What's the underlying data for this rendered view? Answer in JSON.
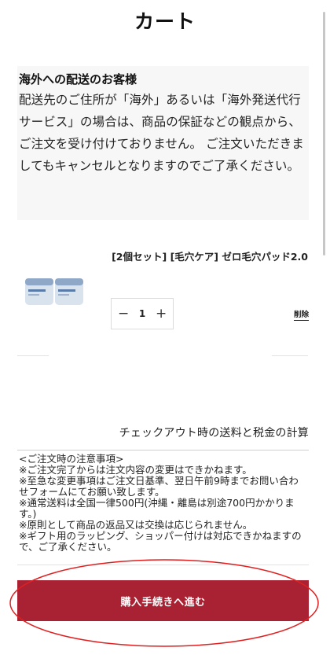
{
  "page": {
    "title": "カート"
  },
  "notice": {
    "heading": "海外への配送のお客様",
    "body": "配送先のご住所が「海外」あるいは「海外発送代行サービス」の場合は、商品の保証などの観点から、ご注文を受け付けておりません。 ご注文いただきましてもキャンセルとなりますのでご了承ください。"
  },
  "cart": {
    "item": {
      "name": "[2個セット] [毛穴ケア] ゼロ毛穴パッド2.0",
      "quantity": "1",
      "minus": "−",
      "plus": "+",
      "delete_label": "削除"
    }
  },
  "checkout": {
    "shipping_tax_note": "チェックアウト時の送料と税金の計算",
    "order_notes": "<ご注文時の注意事項>\n※ご注文完了からは注文内容の変更はできかねます。\n※至急な変更事項はご注文日基準、翌日午前9時までお問い合わせフォームにてお願い致します。\n※通常送料は全国一律500円(沖縄・離島は別途700円かかります。)\n※原則として商品の返品又は交換は応じられません。\n※ギフト用のラッピング、ショッパー付けは対応できかねますので、ご了承ください。",
    "button_label": "購入手続きへ進む",
    "accent_color": "#a82233",
    "annotation_color": "#e02020"
  }
}
